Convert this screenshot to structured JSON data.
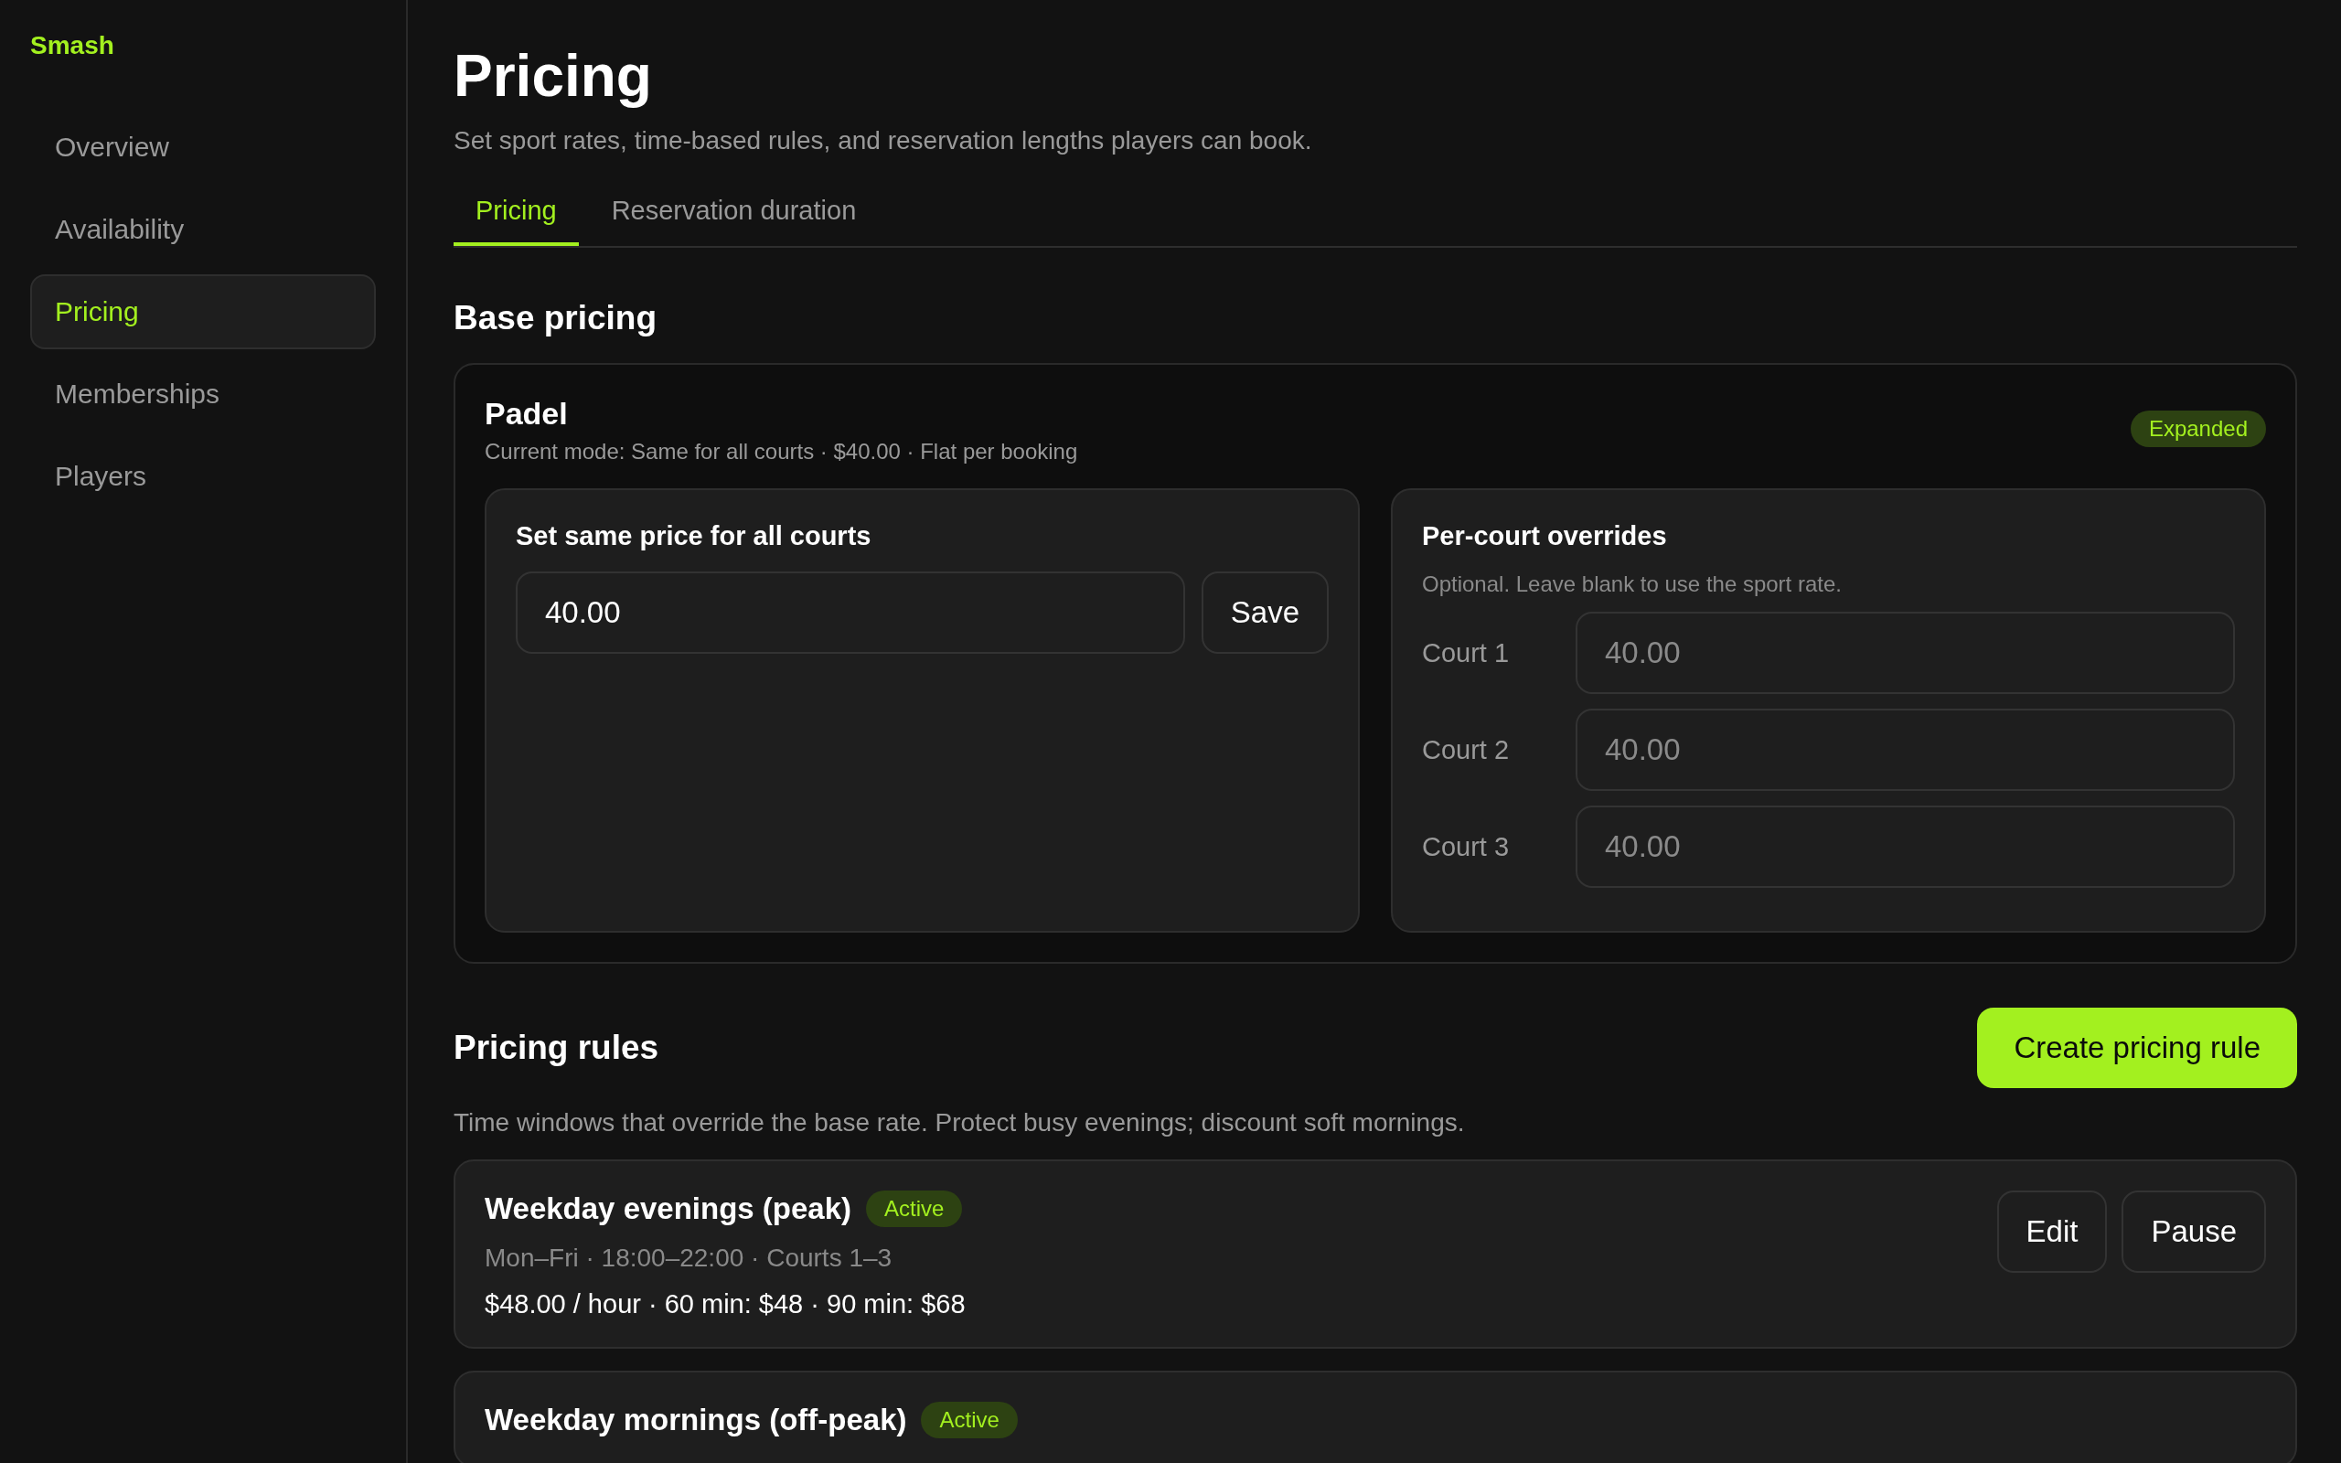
{
  "sidebar": {
    "logo": "Smash",
    "items": [
      {
        "label": "Overview",
        "selected": false
      },
      {
        "label": "Availability",
        "selected": false
      },
      {
        "label": "Pricing",
        "selected": true
      },
      {
        "label": "Memberships",
        "selected": false
      },
      {
        "label": "Players",
        "selected": false
      }
    ]
  },
  "header": {
    "title": "Pricing",
    "subtitle": "Set sport rates, time-based rules, and reservation lengths players can book."
  },
  "tabs": [
    {
      "label": "Pricing",
      "selected": true
    },
    {
      "label": "Reservation duration",
      "selected": false
    }
  ],
  "base_pricing": {
    "heading": "Base pricing",
    "sport": {
      "name": "Padel",
      "mode": "Current mode: Same for all courts · $40.00 · Flat per booking",
      "badge": "Expanded",
      "same_price": {
        "heading": "Set same price for all courts",
        "value": "40.00",
        "button": "Save"
      },
      "overrides": {
        "heading": "Per-court overrides",
        "hint": "Optional. Leave blank to use the sport rate.",
        "courts": [
          {
            "label": "Court 1",
            "placeholder": "40.00"
          },
          {
            "label": "Court 2",
            "placeholder": "40.00"
          },
          {
            "label": "Court 3",
            "placeholder": "40.00"
          }
        ]
      }
    }
  },
  "pricing_rules": {
    "heading": "Pricing rules",
    "create_button": "Create pricing rule",
    "description": "Time windows that override the base rate. Protect busy evenings; discount soft mornings.",
    "rules": [
      {
        "name": "Weekday evenings (peak)",
        "status": "Active",
        "schedule": "Mon–Fri · 18:00–22:00 · Courts 1–3",
        "price": "$48.00 / hour · 60 min: $48 · 90 min: $68",
        "actions": [
          "Edit",
          "Pause"
        ]
      },
      {
        "name": "Weekday mornings (off-peak)",
        "status": "Active"
      }
    ]
  }
}
